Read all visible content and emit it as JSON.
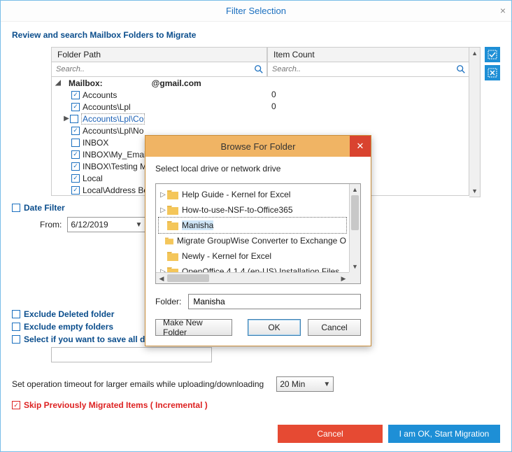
{
  "window": {
    "title": "Filter Selection"
  },
  "heading": "Review and search Mailbox Folders to Migrate",
  "columns": {
    "path": "Folder Path",
    "count": "Item Count"
  },
  "search_placeholder": "Search..",
  "mailbox": {
    "label_prefix": "Mailbox:",
    "address_suffix": "@gmail.com"
  },
  "tree": {
    "items": [
      {
        "label": "Accounts",
        "count": "0",
        "checked": true
      },
      {
        "label": "Accounts\\Lpl",
        "count": "0",
        "checked": true
      },
      {
        "label": "Accounts\\Lpl\\Co",
        "count": "",
        "checked": false,
        "selected": true,
        "caret": true
      },
      {
        "label": "Accounts\\Lpl\\No",
        "count": "",
        "checked": true
      },
      {
        "label": "INBOX",
        "count": "",
        "checked": false
      },
      {
        "label": "INBOX\\My_Email",
        "count": "",
        "checked": true
      },
      {
        "label": "INBOX\\Testing M",
        "count": "",
        "checked": true
      },
      {
        "label": "Local",
        "count": "",
        "checked": true
      },
      {
        "label": "Local\\Address Bo",
        "count": "",
        "checked": true
      }
    ]
  },
  "date_filter": {
    "label": "Date Filter",
    "from_label": "From:",
    "from_value": "6/12/2019"
  },
  "options": {
    "exclude_deleted": "Exclude Deleted folder",
    "exclude_empty": "Exclude empty folders",
    "save_all": "Select if you want to save all dat"
  },
  "timeout": {
    "label": "Set operation timeout for larger emails while uploading/downloading",
    "value": "20 Min"
  },
  "skip": {
    "label": "Skip Previously Migrated Items ( Incremental )"
  },
  "footer": {
    "cancel": "Cancel",
    "ok": "I am OK, Start Migration"
  },
  "modal": {
    "title": "Browse For Folder",
    "instruction": "Select local drive or network drive",
    "items": [
      {
        "label": "Help Guide - Kernel for Excel",
        "expand": true
      },
      {
        "label": "How-to-use-NSF-to-Office365",
        "expand": true
      },
      {
        "label": "Manisha",
        "expand": false,
        "selected": true
      },
      {
        "label": "Migrate GroupWise Converter to Exchange O",
        "expand": false
      },
      {
        "label": "Newly - Kernel for Excel",
        "expand": false
      },
      {
        "label": "OpenOffice 4.1.4 (en-US) Installation Files",
        "expand": true
      }
    ],
    "folder_label": "Folder:",
    "folder_value": "Manisha",
    "make_new": "Make New Folder",
    "ok": "OK",
    "cancel": "Cancel"
  }
}
